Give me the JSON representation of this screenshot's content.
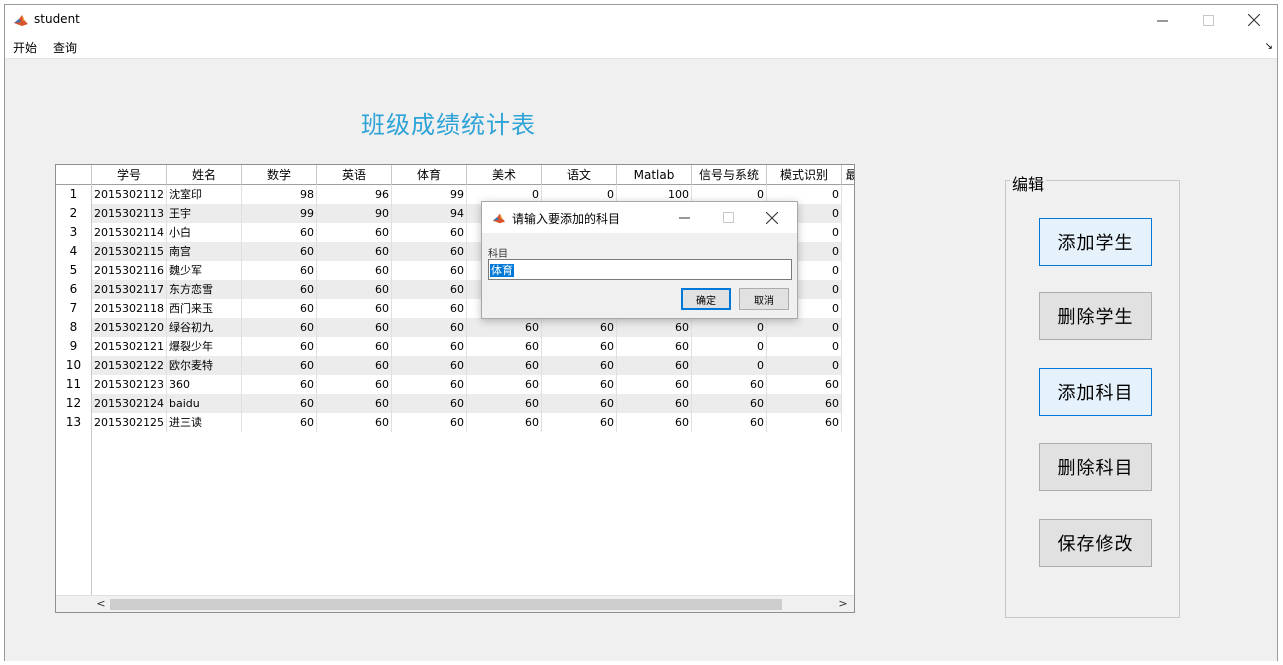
{
  "window": {
    "title": "student",
    "icon": "matlab-icon",
    "controls": {
      "minimize": "—",
      "maximize": "☐",
      "close": "✕"
    }
  },
  "menu": {
    "items": [
      "开始",
      "查询"
    ],
    "overflow_arrow": "↘"
  },
  "page_title": "班级成绩统计表",
  "table": {
    "columns": [
      "学号",
      "姓名",
      "数学",
      "英语",
      "体育",
      "美术",
      "语文",
      "Matlab",
      "信号与系统",
      "模式识别",
      "最"
    ],
    "rows": [
      [
        "1",
        "2015302112",
        "沈室印",
        "98",
        "96",
        "99",
        "0",
        "0",
        "100",
        "0",
        "0"
      ],
      [
        "2",
        "2015302113",
        "王宇",
        "99",
        "90",
        "94",
        "",
        "",
        "",
        "",
        "0"
      ],
      [
        "3",
        "2015302114",
        "小白",
        "60",
        "60",
        "60",
        "",
        "",
        "",
        "",
        "0"
      ],
      [
        "4",
        "2015302115",
        "南宫",
        "60",
        "60",
        "60",
        "",
        "",
        "",
        "",
        "0"
      ],
      [
        "5",
        "2015302116",
        "魏少军",
        "60",
        "60",
        "60",
        "",
        "",
        "",
        "",
        "0"
      ],
      [
        "6",
        "2015302117",
        "东方恋雪",
        "60",
        "60",
        "60",
        "",
        "",
        "",
        "",
        "0"
      ],
      [
        "7",
        "2015302118",
        "西门来玉",
        "60",
        "60",
        "60",
        "",
        "",
        "",
        "",
        "0"
      ],
      [
        "8",
        "2015302120",
        "绿谷初九",
        "60",
        "60",
        "60",
        "60",
        "60",
        "60",
        "0",
        "0"
      ],
      [
        "9",
        "2015302121",
        "爆裂少年",
        "60",
        "60",
        "60",
        "60",
        "60",
        "60",
        "0",
        "0"
      ],
      [
        "10",
        "2015302122",
        "欧尔麦特",
        "60",
        "60",
        "60",
        "60",
        "60",
        "60",
        "0",
        "0"
      ],
      [
        "11",
        "2015302123",
        "360",
        "60",
        "60",
        "60",
        "60",
        "60",
        "60",
        "60",
        "60"
      ],
      [
        "12",
        "2015302124",
        "baidu",
        "60",
        "60",
        "60",
        "60",
        "60",
        "60",
        "60",
        "60"
      ],
      [
        "13",
        "2015302125",
        "进三读",
        "60",
        "60",
        "60",
        "60",
        "60",
        "60",
        "60",
        "60"
      ]
    ],
    "scroll_left": "<",
    "scroll_right": ">"
  },
  "edit_panel": {
    "legend": "编辑",
    "buttons": [
      {
        "label": "添加学生",
        "style": "blue"
      },
      {
        "label": "删除学生",
        "style": "gray"
      },
      {
        "label": "添加科目",
        "style": "blue"
      },
      {
        "label": "删除科目",
        "style": "gray"
      },
      {
        "label": "保存修改",
        "style": "gray"
      }
    ]
  },
  "dialog": {
    "title": "请输入要添加的科目",
    "field_label": "科目",
    "field_value": "体育",
    "ok_label": "确定",
    "cancel_label": "取消",
    "controls": {
      "minimize": "—",
      "maximize": "☐",
      "close": "✕"
    }
  },
  "colors": {
    "title_blue": "#2ea3d8",
    "accent": "#0078d7",
    "button_blue_bg": "#e5f1fb",
    "button_gray_bg": "#e1e1e1"
  }
}
